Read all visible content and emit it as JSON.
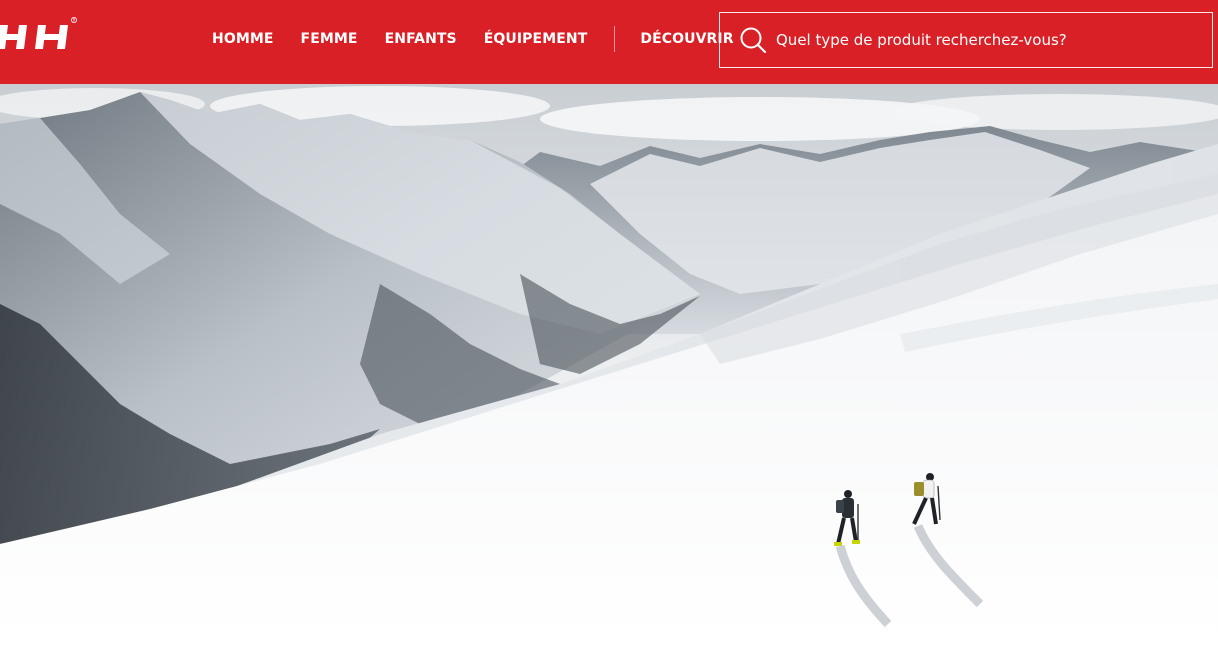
{
  "brand": {
    "logo_text": "HH",
    "colors": {
      "primary": "#da2027",
      "text": "#ffffff"
    }
  },
  "nav": {
    "items": [
      {
        "label": "HOMME"
      },
      {
        "label": "FEMME"
      },
      {
        "label": "ENFANTS"
      },
      {
        "label": "ÉQUIPEMENT"
      }
    ],
    "discover": {
      "label": "DÉCOUVRIR"
    }
  },
  "search": {
    "placeholder": "Quel type de produit recherchez-vous?",
    "icon": "search-icon"
  },
  "hero": {
    "image": "mountain-hero-image",
    "subject": "ski-touring-hikers"
  }
}
